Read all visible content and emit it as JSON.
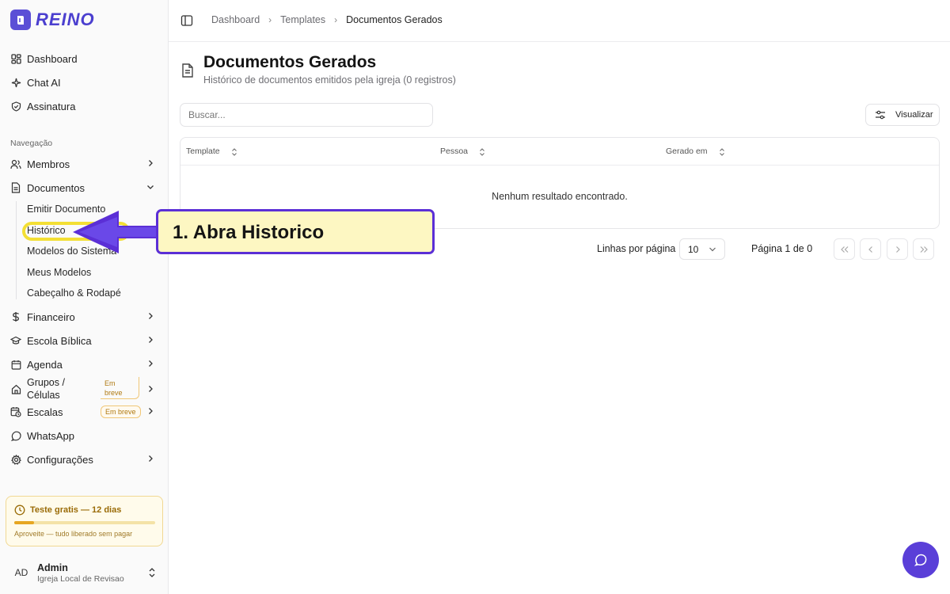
{
  "brand": {
    "name": "REINO"
  },
  "sidebar": {
    "top_items": [
      {
        "label": "Dashboard",
        "icon": "grid-icon"
      },
      {
        "label": "Chat AI",
        "icon": "sparkle-icon"
      },
      {
        "label": "Assinatura",
        "icon": "shield-check-icon"
      }
    ],
    "section_label": "Navegação",
    "items": [
      {
        "label": "Membros",
        "icon": "users-icon",
        "chevron": "right"
      },
      {
        "label": "Documentos",
        "icon": "file-text-icon",
        "chevron": "down"
      },
      {
        "label": "Financeiro",
        "icon": "dollar-icon",
        "chevron": "right"
      },
      {
        "label": "Escola Bíblica",
        "icon": "graduation-cap-icon",
        "chevron": "right"
      },
      {
        "label": "Agenda",
        "icon": "calendar-icon",
        "chevron": "right"
      },
      {
        "label": "Grupos / Células",
        "icon": "home-icon",
        "chevron": "right",
        "badge": "Em breve"
      },
      {
        "label": "Escalas",
        "icon": "calendar-clock-icon",
        "chevron": "right",
        "badge": "Em breve"
      },
      {
        "label": "WhatsApp",
        "icon": "message-circle-icon"
      },
      {
        "label": "Configurações",
        "icon": "gear-icon",
        "chevron": "right"
      }
    ],
    "doc_subitems": [
      "Emitir Documento",
      "Histórico",
      "Modelos do Sistema",
      "Meus Modelos",
      "Cabeçalho & Rodapé"
    ],
    "trial": {
      "title": "Teste gratis — 12 dias",
      "progress": 0.14,
      "note": "Aproveite — tudo liberado sem pagar"
    },
    "user": {
      "initials": "AD",
      "name": "Admin",
      "org": "Igreja Local de Revisao"
    }
  },
  "breadcrumb": [
    "Dashboard",
    "Templates",
    "Documentos Gerados"
  ],
  "page": {
    "title": "Documentos Gerados",
    "subtitle": "Histórico de documentos emitidos pela igreja (0 registros)"
  },
  "toolbar": {
    "search_placeholder": "Buscar...",
    "view_label": "Visualizar"
  },
  "table": {
    "columns": [
      "Template",
      "Pessoa",
      "Gerado em"
    ],
    "empty_message": "Nenhum resultado encontrado."
  },
  "pagination": {
    "rows_label": "Linhas por página",
    "rows_value": "10",
    "page_info": "Página 1 de 0"
  },
  "annotation": {
    "text": "1. Abra Historico"
  },
  "colors": {
    "accent": "#5a3fd8",
    "highlight": "#f3df34",
    "callout_bg": "#fdf7c2"
  }
}
